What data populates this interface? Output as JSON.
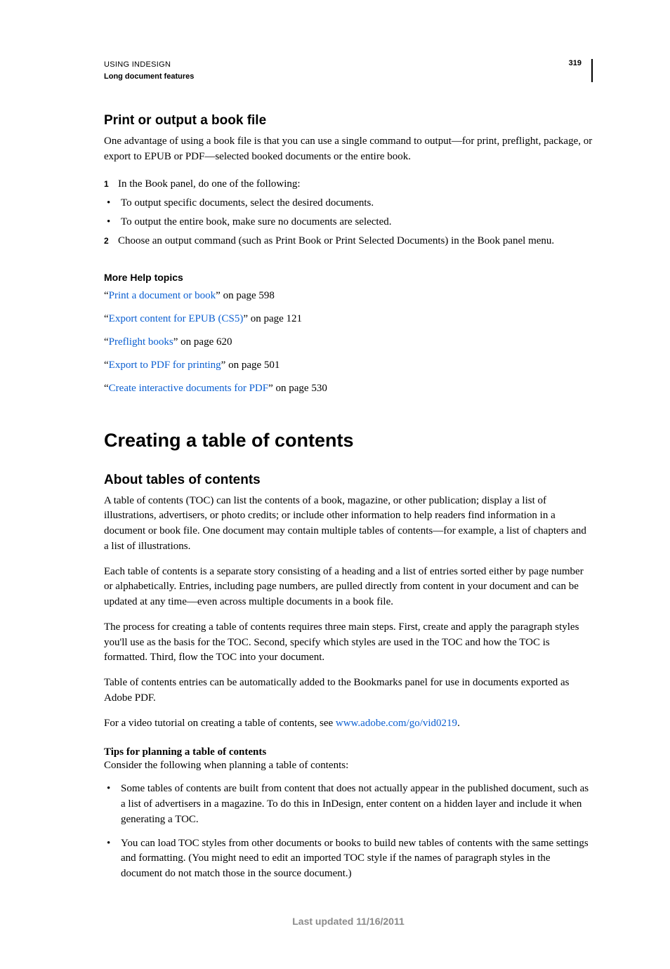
{
  "header": {
    "line1": "USING INDESIGN",
    "line2": "Long document features",
    "pageNum": "319"
  },
  "sec1": {
    "title": "Print or output a book file",
    "intro": "One advantage of using a book file is that you can use a single command to output—for print, preflight, package, or export to EPUB or PDF—selected booked documents or the entire book.",
    "steps": [
      {
        "num": "1",
        "text": "In the Book panel, do one of the following:"
      },
      {
        "bullet": "•",
        "text": "To output specific documents, select the desired documents."
      },
      {
        "bullet": "•",
        "text": "To output the entire book, make sure no documents are selected."
      },
      {
        "num": "2",
        "text": "Choose an output command (such as Print Book or Print Selected Documents) in the Book panel menu."
      }
    ]
  },
  "help": {
    "title": "More Help topics",
    "links": [
      {
        "q1": "“",
        "label": "Print a document or book",
        "suffix": "” on page 598"
      },
      {
        "q1": "“",
        "label": "Export content for EPUB (CS5)",
        "suffix": "” on page 121"
      },
      {
        "q1": "“",
        "label": "Preflight books",
        "suffix": "” on page 620"
      },
      {
        "q1": "“",
        "label": "Export to PDF for printing",
        "suffix": "” on page 501"
      },
      {
        "q1": "“",
        "label": "Create interactive documents for PDF",
        "suffix": "” on page 530"
      }
    ]
  },
  "chapter": {
    "title": "Creating a table of contents"
  },
  "sec2": {
    "title": "About tables of contents",
    "p1": "A table of contents (TOC) can list the contents of a book, magazine, or other publication; display a list of illustrations, advertisers, or photo credits; or include other information to help readers find information in a document or book file. One document may contain multiple tables of contents—for example, a list of chapters and a list of illustrations.",
    "p2": "Each table of contents is a separate story consisting of a heading and a list of entries sorted either by page number or alphabetically. Entries, including page numbers, are pulled directly from content in your document and can be updated at any time—even across multiple documents in a book file.",
    "p3": "The process for creating a table of contents requires three main steps. First, create and apply the paragraph styles you'll use as the basis for the TOC. Second, specify which styles are used in the TOC and how the TOC is formatted. Third, flow the TOC into your document.",
    "p4": "Table of contents entries can be automatically added to the Bookmarks panel for use in documents exported as Adobe PDF.",
    "p5_pre": "For a video tutorial on creating a table of contents, see ",
    "p5_link": "www.adobe.com/go/vid0219",
    "p5_post": "."
  },
  "tips": {
    "title": "Tips for planning a table of contents",
    "intro": "Consider the following when planning a table of contents:",
    "items": [
      "Some tables of contents are built from content that does not actually appear in the published document, such as a list of advertisers in a magazine. To do this in InDesign, enter content on a hidden layer and include it when generating a TOC.",
      "You can load TOC styles from other documents or books to build new tables of contents with the same settings and formatting. (You might need to edit an imported TOC style if the names of paragraph styles in the document do not match those in the source document.)"
    ]
  },
  "footer": "Last updated 11/16/2011"
}
